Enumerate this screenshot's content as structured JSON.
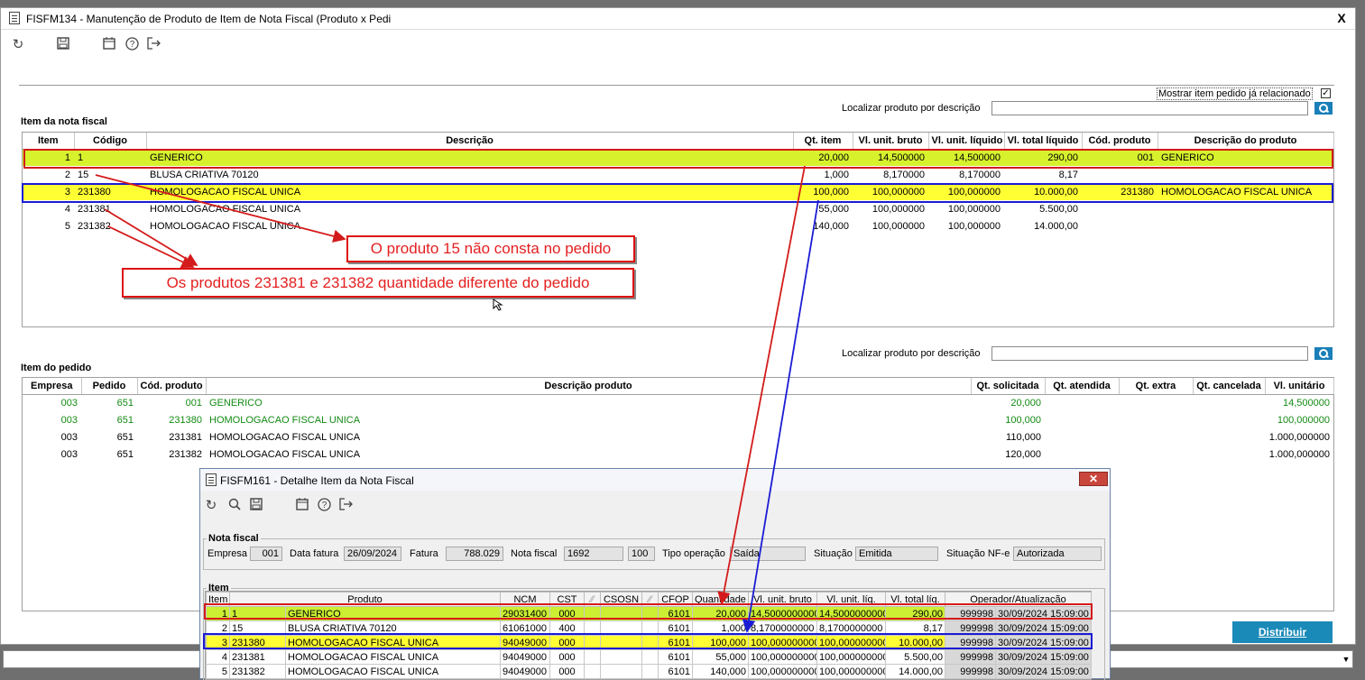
{
  "main_window": {
    "title": "FISFM134 - Manutenção de Produto de Item de Nota Fiscal (Produto x Pedi",
    "close_glyph": "X",
    "toolbar": [
      "undo-icon",
      "save-icon",
      "calendar-icon",
      "help-icon",
      "exit-icon"
    ],
    "show_related_label": "Mostrar item pedido já relacionado",
    "show_related_checked": "✓",
    "search_label": "Localizar produto por descrição",
    "search_value": "",
    "distribute_label": "Distribuir"
  },
  "nf_items": {
    "title": "Item da nota fiscal",
    "columns": [
      "Item",
      "Código",
      "Descrição",
      "Qt. item",
      "Vl. unit. bruto",
      "Vl. unit. líquido",
      "Vl. total líquido",
      "Cód. produto",
      "Descrição do produto"
    ],
    "rows": [
      [
        "1",
        "1",
        "GENERICO",
        "20,000",
        "14,500000",
        "14,500000",
        "290,00",
        "001",
        "GENERICO"
      ],
      [
        "2",
        "15",
        "BLUSA CRIATIVA 70120",
        "1,000",
        "8,170000",
        "8,170000",
        "8,17",
        "",
        ""
      ],
      [
        "3",
        "231380",
        "HOMOLOGACAO FISCAL UNICA",
        "100,000",
        "100,000000",
        "100,000000",
        "10.000,00",
        "231380",
        "HOMOLOGACAO FISCAL UNICA"
      ],
      [
        "4",
        "231381",
        "HOMOLOGACAO FISCAL UNICA",
        "55,000",
        "100,000000",
        "100,000000",
        "5.500,00",
        "",
        ""
      ],
      [
        "5",
        "231382",
        "HOMOLOGACAO FISCAL UNICA",
        "140,000",
        "100,000000",
        "100,000000",
        "14.000,00",
        "",
        ""
      ]
    ]
  },
  "order_items": {
    "title": "Item do pedido",
    "search_label": "Localizar produto por descrição",
    "search_value": "",
    "columns": [
      "Empresa",
      "Pedido",
      "Cód. produto",
      "Descrição produto",
      "Qt. solicitada",
      "Qt. atendida",
      "Qt. extra",
      "Qt. cancelada",
      "Vl. unitário"
    ],
    "rows": [
      [
        "003",
        "651",
        "001",
        "GENERICO",
        "20,000",
        "",
        "",
        "",
        "14,500000"
      ],
      [
        "003",
        "651",
        "231380",
        "HOMOLOGACAO FISCAL UNICA",
        "100,000",
        "",
        "",
        "",
        "100,000000"
      ],
      [
        "003",
        "651",
        "231381",
        "HOMOLOGACAO FISCAL UNICA",
        "110,000",
        "",
        "",
        "",
        "1.000,000000"
      ],
      [
        "003",
        "651",
        "231382",
        "HOMOLOGACAO FISCAL UNICA",
        "120,000",
        "",
        "",
        "",
        "1.000,000000"
      ]
    ]
  },
  "annotations": {
    "callout_1": "O produto 15 não consta no pedido",
    "callout_2": "Os produtos 231381 e 231382 quantidade diferente do pedido",
    "red_color": "#d41b1b",
    "blue_color": "#1b1bd4"
  },
  "detail_window": {
    "title": "FISFM161 - Detalhe Item da Nota Fiscal",
    "close_glyph": "✕",
    "toolbar": [
      "undo-icon",
      "search-icon",
      "save-icon",
      "calendar-icon",
      "help-icon",
      "exit-icon"
    ],
    "nota_fiscal_legend": "Nota fiscal",
    "empresa_label": "Empresa",
    "empresa_value": "001",
    "data_fatura_label": "Data fatura",
    "data_fatura_value": "26/09/2024",
    "fatura_label": "Fatura",
    "fatura_value": "788.029",
    "nota_fiscal_label": "Nota fiscal",
    "nota_fiscal_value": "1692",
    "serie_value": "100",
    "tipo_operacao_label": "Tipo operação",
    "tipo_operacao_value": "Saída",
    "situacao_label": "Situação",
    "situacao_value": "Emitida",
    "situacao_nfe_label": "Situação NF-e",
    "situacao_nfe_value": "Autorizada",
    "item_legend": "Item",
    "columns": [
      "Item",
      "Produto",
      "",
      "NCM",
      "CST",
      "",
      "CSOSN",
      "",
      "CFOP",
      "Quantidade",
      "Vl. unit. bruto",
      "Vl. unit. líq.",
      "Vl. total líq.",
      "Operador/Atualização"
    ],
    "rows": [
      [
        "1",
        "1",
        "GENERICO",
        "29031400",
        "000",
        "",
        "",
        "",
        "6101",
        "20,000",
        "14,5000000000",
        "14,5000000000",
        "290,00",
        "999998",
        "30/09/2024 15:09:00"
      ],
      [
        "2",
        "15",
        "BLUSA CRIATIVA 70120",
        "61061000",
        "400",
        "",
        "",
        "",
        "6101",
        "1,000",
        "8,1700000000",
        "8,1700000000",
        "8,17",
        "999998",
        "30/09/2024 15:09:00"
      ],
      [
        "3",
        "231380",
        "HOMOLOGACAO FISCAL UNICA",
        "94049000",
        "000",
        "",
        "",
        "",
        "6101",
        "100,000",
        "100,0000000000",
        "100,0000000000",
        "10.000,00",
        "999998",
        "30/09/2024 15:09:00"
      ],
      [
        "4",
        "231381",
        "HOMOLOGACAO FISCAL UNICA",
        "94049000",
        "000",
        "",
        "",
        "",
        "6101",
        "55,000",
        "100,0000000000",
        "100,0000000000",
        "5.500,00",
        "999998",
        "30/09/2024 15:09:00"
      ],
      [
        "5",
        "231382",
        "HOMOLOGACAO FISCAL UNICA",
        "94049000",
        "000",
        "",
        "",
        "",
        "6101",
        "140,000",
        "100,0000000000",
        "100,0000000000",
        "14.000,00",
        "999998",
        "30/09/2024 15:09:00"
      ]
    ]
  }
}
